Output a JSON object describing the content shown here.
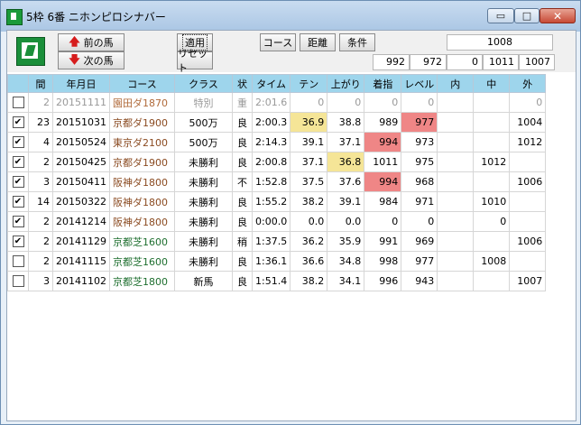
{
  "window": {
    "title": "5枠 6番 ニホンピロシナバー",
    "controls": {
      "minimize": "▭",
      "maximize": "□",
      "close": "✕"
    }
  },
  "toolbar": {
    "prev_label": "前の馬",
    "next_label": "次の馬",
    "apply_label": "適用",
    "reset_label": "リセット",
    "course_label": "コース",
    "distance_label": "距離",
    "condition_label": "条件",
    "top_value": "1008",
    "summary": [
      "992",
      "972",
      "0",
      "1011",
      "1007"
    ]
  },
  "table": {
    "headers": [
      "",
      "間",
      "年月日",
      "コース",
      "クラス",
      "状",
      "タイム",
      "テン",
      "上がり",
      "着指",
      "レベル",
      "内",
      "中",
      "外"
    ],
    "rows": [
      {
        "checked": false,
        "gap": "2",
        "date": "20151111",
        "course": "園田ダ1870",
        "surface": "dirt",
        "class": "特別",
        "cond": "重",
        "time": "2:01.6",
        "ten": "0",
        "agari": "0",
        "chaku": "0",
        "level": "0",
        "uchi": "",
        "naka": "",
        "soto": "0",
        "dim": true
      },
      {
        "checked": true,
        "gap": "23",
        "date": "20151031",
        "course": "京都ダ1900",
        "surface": "dirt",
        "class": "500万",
        "cond": "良",
        "time": "2:00.3",
        "ten": "36.9",
        "agari": "38.8",
        "chaku": "989",
        "level": "977",
        "uchi": "",
        "naka": "",
        "soto": "1004",
        "hl_ten": "yellow",
        "hl_level": "red"
      },
      {
        "checked": true,
        "gap": "4",
        "date": "20150524",
        "course": "東京ダ2100",
        "surface": "dirt",
        "class": "500万",
        "cond": "良",
        "time": "2:14.3",
        "ten": "39.1",
        "agari": "37.1",
        "chaku": "994",
        "level": "973",
        "uchi": "",
        "naka": "",
        "soto": "1012",
        "hl_chaku": "red"
      },
      {
        "checked": true,
        "gap": "2",
        "date": "20150425",
        "course": "京都ダ1900",
        "surface": "dirt",
        "class": "未勝利",
        "cond": "良",
        "time": "2:00.8",
        "ten": "37.1",
        "agari": "36.8",
        "chaku": "1011",
        "level": "975",
        "uchi": "",
        "naka": "1012",
        "soto": "",
        "hl_agari": "yellow"
      },
      {
        "checked": true,
        "gap": "3",
        "date": "20150411",
        "course": "阪神ダ1800",
        "surface": "dirt",
        "class": "未勝利",
        "cond": "不",
        "time": "1:52.8",
        "ten": "37.5",
        "agari": "37.6",
        "chaku": "994",
        "level": "968",
        "uchi": "",
        "naka": "",
        "soto": "1006",
        "hl_chaku": "red"
      },
      {
        "checked": true,
        "gap": "14",
        "date": "20150322",
        "course": "阪神ダ1800",
        "surface": "dirt",
        "class": "未勝利",
        "cond": "良",
        "time": "1:55.2",
        "ten": "38.2",
        "agari": "39.1",
        "chaku": "984",
        "level": "971",
        "uchi": "",
        "naka": "1010",
        "soto": ""
      },
      {
        "checked": true,
        "gap": "2",
        "date": "20141214",
        "course": "阪神ダ1800",
        "surface": "dirt",
        "class": "未勝利",
        "cond": "良",
        "time": "0:00.0",
        "ten": "0.0",
        "agari": "0.0",
        "chaku": "0",
        "level": "0",
        "uchi": "",
        "naka": "0",
        "soto": ""
      },
      {
        "checked": true,
        "gap": "2",
        "date": "20141129",
        "course": "京都芝1600",
        "surface": "turf",
        "class": "未勝利",
        "cond": "稍",
        "time": "1:37.5",
        "ten": "36.2",
        "agari": "35.9",
        "chaku": "991",
        "level": "969",
        "uchi": "",
        "naka": "",
        "soto": "1006"
      },
      {
        "checked": false,
        "gap": "2",
        "date": "20141115",
        "course": "京都芝1600",
        "surface": "turf",
        "class": "未勝利",
        "cond": "良",
        "time": "1:36.1",
        "ten": "36.6",
        "agari": "34.8",
        "chaku": "998",
        "level": "977",
        "uchi": "",
        "naka": "1008",
        "soto": ""
      },
      {
        "checked": false,
        "gap": "3",
        "date": "20141102",
        "course": "京都芝1800",
        "surface": "turf",
        "class": "新馬",
        "cond": "良",
        "time": "1:51.4",
        "ten": "38.2",
        "agari": "34.1",
        "chaku": "996",
        "level": "943",
        "uchi": "",
        "naka": "",
        "soto": "1007"
      }
    ]
  }
}
